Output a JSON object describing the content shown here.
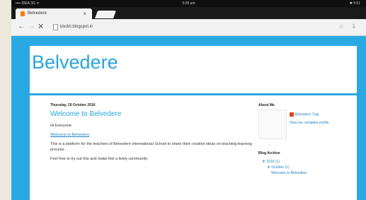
{
  "statusbar": {
    "left": "•••• IDEA 3G ᯤ",
    "time": "5:09 pm",
    "right": "✱ 5:51"
  },
  "tab": {
    "title": "Belvedere",
    "close": "×"
  },
  "toolbar": {
    "back": "←",
    "forward": "→",
    "stop": "✕",
    "url": "bivdrii.blogspot.in",
    "star": "☆",
    "download": "⇓"
  },
  "blog": {
    "title": "Belvedere",
    "post": {
      "date": "Thursday, 20 October 2016",
      "title": "Welcome to Belvedere",
      "paragraphs": [
        "Hi Everyone",
        "Welcome to Belvedere",
        "This is a platform for the teachers of Belvedere International School to share their creative ideas on teaching-learning process.",
        "Feel free to try out this and make this a lively community."
      ]
    },
    "sidebar": {
      "about_heading": "About Me",
      "profile_name": "Belvedere Trial",
      "profile_link": "View my complete profile",
      "archive_heading": "Blog Archive",
      "archive": [
        "▼ 2016 (1)",
        "▼ October (1)",
        "Welcome to Belvedere"
      ]
    }
  },
  "colors": {
    "accent": "#27a4dc",
    "page_bg": "#29a9e4",
    "link": "#1f7fc0"
  }
}
